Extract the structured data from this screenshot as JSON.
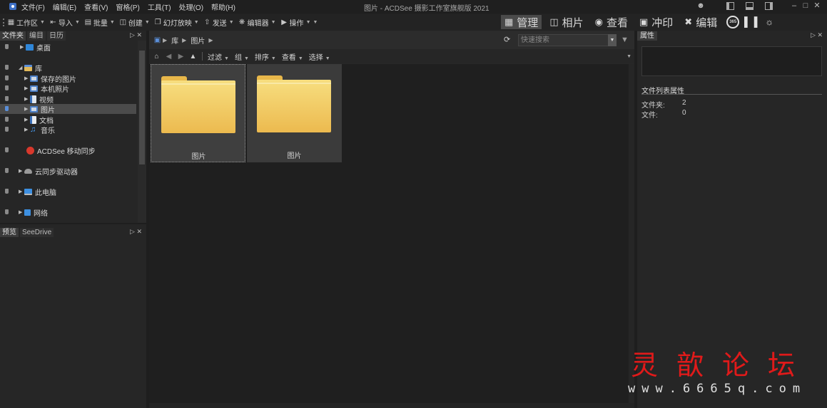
{
  "menubar": {
    "items": [
      "文件(F)",
      "编辑(E)",
      "查看(V)",
      "窗格(P)",
      "工具(T)",
      "处理(O)",
      "帮助(H)"
    ],
    "window_title": "图片 - ACDSee 摄影工作室旗舰版 2021"
  },
  "toolbar": {
    "items": [
      {
        "label": "工作区",
        "icon": "workspace-icon"
      },
      {
        "label": "导入",
        "icon": "import-icon"
      },
      {
        "label": "批量",
        "icon": "batch-icon"
      },
      {
        "label": "创建",
        "icon": "create-icon"
      },
      {
        "label": "幻灯放映",
        "icon": "slideshow-icon"
      },
      {
        "label": "发送",
        "icon": "send-icon"
      },
      {
        "label": "编辑器",
        "icon": "editor-icon"
      },
      {
        "label": "操作",
        "icon": "actions-icon"
      }
    ],
    "modes": [
      {
        "label": "管理",
        "icon": "manage-grid-icon",
        "active": true
      },
      {
        "label": "相片",
        "icon": "photos-icon",
        "active": false
      },
      {
        "label": "查看",
        "icon": "eye-icon",
        "active": false
      },
      {
        "label": "冲印",
        "icon": "develop-icon",
        "active": false
      },
      {
        "label": "编辑",
        "icon": "edit-tools-icon",
        "active": false
      }
    ],
    "mode_365_label": "365"
  },
  "left_panel": {
    "tabs": [
      "文件夹",
      "编目",
      "日历"
    ],
    "tree": [
      {
        "label": "桌面",
        "icon": "desktop-icon",
        "selected": false
      },
      {
        "label": "库",
        "icon": "library-icon",
        "selected": false
      },
      {
        "label": "保存的图片",
        "icon": "saved-pictures-icon",
        "selected": false
      },
      {
        "label": "本机照片",
        "icon": "camera-roll-icon",
        "selected": false
      },
      {
        "label": "视频",
        "icon": "video-icon",
        "selected": false
      },
      {
        "label": "图片",
        "icon": "pictures-icon",
        "selected": true
      },
      {
        "label": "文档",
        "icon": "documents-icon",
        "selected": false
      },
      {
        "label": "音乐",
        "icon": "music-icon",
        "selected": false
      },
      {
        "label": "ACDSee 移动同步",
        "icon": "acdsee-mobile-sync-icon",
        "selected": false
      },
      {
        "label": "云同步驱动器",
        "icon": "cloud-sync-icon",
        "selected": false
      },
      {
        "label": "此电脑",
        "icon": "this-pc-icon",
        "selected": false
      },
      {
        "label": "网络",
        "icon": "network-icon",
        "selected": false
      }
    ]
  },
  "preview_panel": {
    "tabs": [
      "预览",
      "SeeDrive"
    ]
  },
  "center": {
    "breadcrumb": [
      "库",
      "图片"
    ],
    "search_placeholder": "快速搜索",
    "nav_menus": [
      "过滤",
      "组",
      "排序",
      "查看",
      "选择"
    ],
    "files": [
      {
        "label": "图片",
        "type": "folder",
        "focused": true
      },
      {
        "label": "图片",
        "type": "folder",
        "focused": false
      }
    ]
  },
  "right_panel": {
    "tab": "属性",
    "section_title": "文件列表属性",
    "rows": [
      {
        "key": "文件夹:",
        "value": "2"
      },
      {
        "key": "文件:",
        "value": "0"
      }
    ]
  },
  "watermark": {
    "chinese": "灵歆论坛",
    "url": "www.6665q.com"
  }
}
